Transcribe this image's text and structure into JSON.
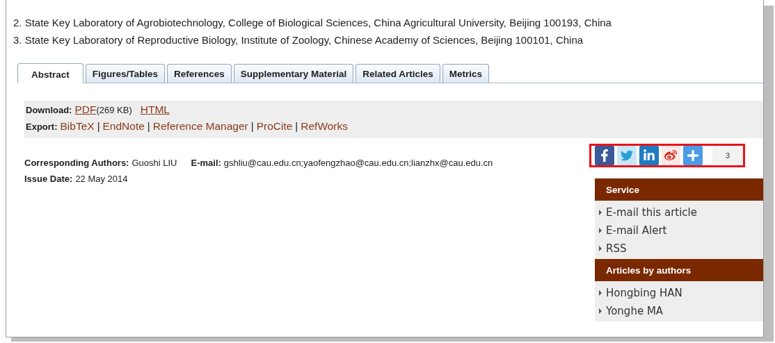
{
  "affiliations": [
    "2. State Key Laboratory of Agrobiotechnology, College of Biological Sciences, China Agricultural University, Beijing 100193, China",
    "3. State Key Laboratory of Reproductive Biology, Institute of Zoology, Chinese Academy of Sciences, Beijing 100101, China"
  ],
  "tabs": [
    {
      "label": "Abstract",
      "selected": true
    },
    {
      "label": "Figures/Tables",
      "selected": false
    },
    {
      "label": "References",
      "selected": false
    },
    {
      "label": "Supplementary Material",
      "selected": false
    },
    {
      "label": "Related Articles",
      "selected": false
    },
    {
      "label": "Metrics",
      "selected": false
    }
  ],
  "download": {
    "label": "Download:",
    "pdf": "PDF",
    "size": "(269 KB)",
    "html": "HTML"
  },
  "export": {
    "label": "Export:",
    "links": [
      "BibTeX",
      "EndNote",
      "Reference Manager",
      "ProCite",
      "RefWorks"
    ],
    "separator": "|"
  },
  "corresponding": {
    "label": "Corresponding Authors:",
    "value": "Guoshi LIU"
  },
  "email": {
    "label": "E-mail:",
    "value": "gshliu@cau.edu.cn;yaofengzhao@cau.edu.cn;lianzhx@cau.edu.cn"
  },
  "issue_date": {
    "label": "Issue Date:",
    "value": "22 May 2014"
  },
  "share": {
    "buttons": [
      {
        "kind": "facebook"
      },
      {
        "kind": "twitter"
      },
      {
        "kind": "linkedin"
      },
      {
        "kind": "weibo"
      },
      {
        "kind": "plus"
      }
    ],
    "count": "3",
    "highlighted": true
  },
  "sidebar": [
    {
      "title": "Service",
      "items": [
        "E-mail this article",
        "E-mail Alert",
        "RSS"
      ]
    },
    {
      "title": "Articles by authors",
      "items": [
        "Hongbing HAN",
        "Yonghe MA"
      ]
    }
  ]
}
